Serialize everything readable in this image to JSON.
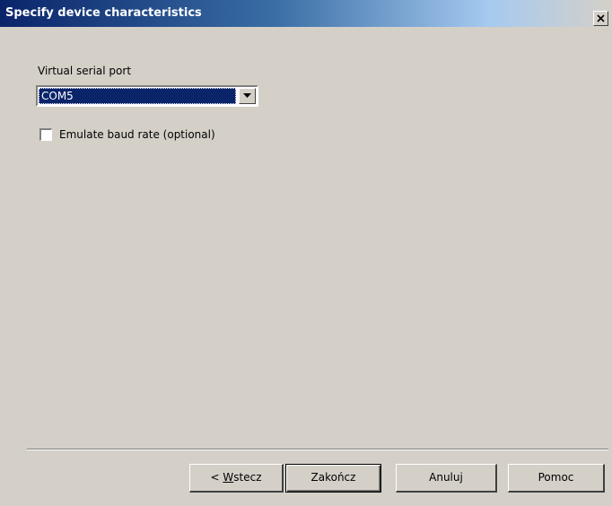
{
  "window": {
    "title": "Specify device characteristics"
  },
  "form": {
    "port_label": "Virtual serial port",
    "port_selected": "COM5",
    "emulate_baud_label": "Emulate baud rate (optional)",
    "emulate_baud_checked": false
  },
  "buttons": {
    "back_prefix": "< ",
    "back_mnemonic": "W",
    "back_rest": "stecz",
    "finish": "Zakończ",
    "cancel": "Anuluj",
    "help": "Pomoc"
  },
  "icons": {
    "close": "close-icon",
    "dropdown": "chevron-down-icon"
  },
  "colors": {
    "title_bar_start": "#0a246a",
    "dialog_face": "#d4d0c8",
    "selection": "#0a246a"
  }
}
